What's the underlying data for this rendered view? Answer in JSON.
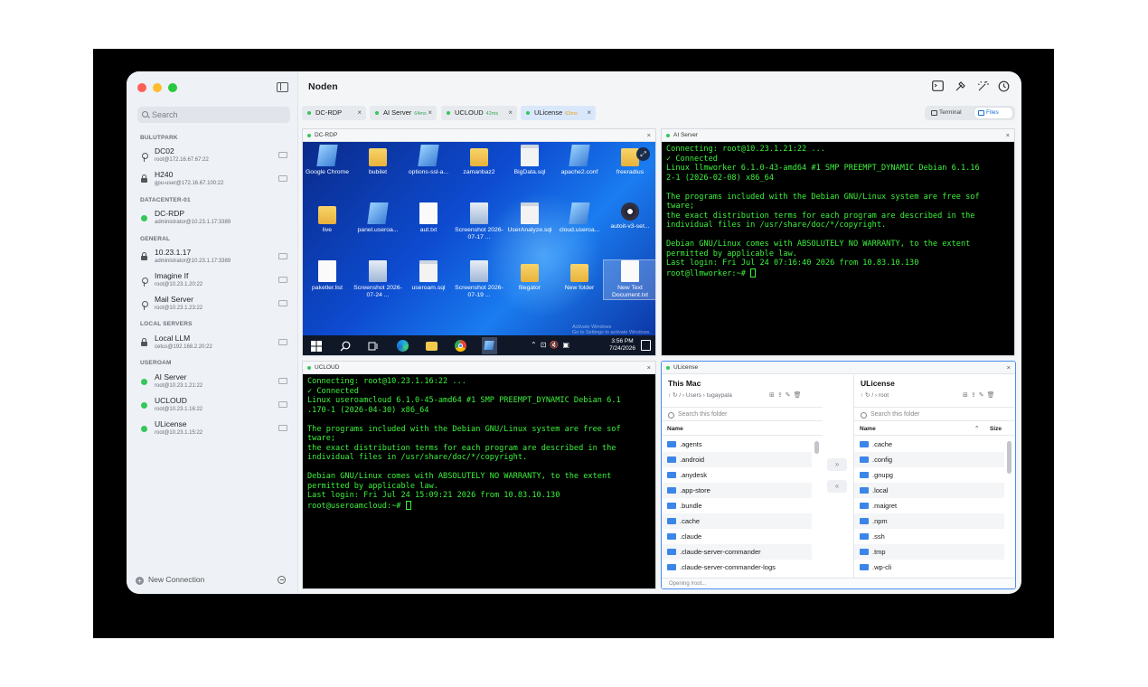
{
  "app": {
    "title": "Noden",
    "colors": {
      "close": "#ff5f57",
      "minimize": "#febc2e",
      "zoom": "#28c840",
      "accent": "#1a6fd8",
      "terminal_text": "#3cf23c",
      "online": "#34c759"
    }
  },
  "sidebar": {
    "search_placeholder": "Search",
    "groups": [
      {
        "label": "BULUTPARK",
        "items": [
          {
            "name": "DC02",
            "sub": "root@172.16.67.67:22",
            "status": "key"
          },
          {
            "name": "H240",
            "sub": "gpu-user@172.16.67.100:22",
            "status": "lock"
          }
        ]
      },
      {
        "label": "DATACENTER-01",
        "items": [
          {
            "name": "DC-RDP",
            "sub": "administrator@10.23.1.17:3389",
            "status": "online"
          }
        ]
      },
      {
        "label": "GENERAL",
        "items": [
          {
            "name": "10.23.1.17",
            "sub": "administrator@10.23.1.17:3389",
            "status": "lock"
          },
          {
            "name": "Imagine If",
            "sub": "root@10.23.1.20:22",
            "status": "key"
          },
          {
            "name": "Mail Server",
            "sub": "root@10.23.1.23:22",
            "status": "key"
          }
        ]
      },
      {
        "label": "LOCAL SERVERS",
        "items": [
          {
            "name": "Local LLM",
            "sub": "cetus@192.168.2.20:22",
            "status": "lock"
          }
        ]
      },
      {
        "label": "USEROAM",
        "items": [
          {
            "name": "AI Server",
            "sub": "root@10.23.1.21:22",
            "status": "online"
          },
          {
            "name": "UCLOUD",
            "sub": "root@10.23.1.16:22",
            "status": "online"
          },
          {
            "name": "ULicense",
            "sub": "root@10.23.1.15:22",
            "status": "online"
          }
        ]
      }
    ],
    "new_connection": "New Connection"
  },
  "toolbar": {
    "icons": [
      "terminal-window-icon",
      "hammer-icon",
      "magic-wand-icon",
      "history-icon"
    ]
  },
  "tabs": [
    {
      "label": "DC-RDP",
      "latency": ""
    },
    {
      "label": "AI Server",
      "latency": "64ms"
    },
    {
      "label": "UCLOUD",
      "latency": "42ms"
    },
    {
      "label": "ULicense",
      "latency": "63ms"
    }
  ],
  "view_toggle": {
    "terminal": "Terminal",
    "files": "Files"
  },
  "panes": {
    "rdp": {
      "title": "DC-RDP",
      "desktop_icons": [
        {
          "label": "Google Chrome",
          "kind": "app"
        },
        {
          "label": "bubilet",
          "kind": "folder"
        },
        {
          "label": "options-ssl-a...",
          "kind": "app"
        },
        {
          "label": "zamanbaz2",
          "kind": "folder"
        },
        {
          "label": "BigData.sql",
          "kind": "sql"
        },
        {
          "label": "apache2.conf",
          "kind": "app"
        },
        {
          "label": "freeradius",
          "kind": "folder"
        },
        {
          "label": "live",
          "kind": "folder"
        },
        {
          "label": "panel.userоа...",
          "kind": "app"
        },
        {
          "label": "aut.txt",
          "kind": "doc"
        },
        {
          "label": "Screenshot 2026-07-17 ...",
          "kind": "img"
        },
        {
          "label": "UserAnalyze.sql",
          "kind": "sql"
        },
        {
          "label": "cloud.useroa...",
          "kind": "app"
        },
        {
          "label": "autoit-v3-set...",
          "kind": "round"
        },
        {
          "label": "paketler.list",
          "kind": "doc"
        },
        {
          "label": "Screenshot 2026-07-24 ...",
          "kind": "img"
        },
        {
          "label": "useroam.sql",
          "kind": "sql"
        },
        {
          "label": "Screenshot 2026-07-19 ...",
          "kind": "img"
        },
        {
          "label": "filegator",
          "kind": "folder"
        },
        {
          "label": "New folder",
          "kind": "folder"
        },
        {
          "label": "New Text Document.txt",
          "kind": "doc"
        }
      ],
      "watermark": "Activate Windows\nGo to Settings to activate Windows.",
      "clock_time": "3:56 PM",
      "clock_date": "7/24/2026"
    },
    "ai_server": {
      "title": "AI Server",
      "lines": "Connecting: root@10.23.1.21:22 ...\n✓ Connected\nLinux llmworker 6.1.0-43-amd64 #1 SMP PREEMPT_DYNAMIC Debian 6.1.16\n2-1 (2026-02-08) x86_64\n\nThe programs included with the Debian GNU/Linux system are free sof\ntware;\nthe exact distribution terms for each program are described in the\nindividual files in /usr/share/doc/*/copyright.\n\nDebian GNU/Linux comes with ABSOLUTELY NO WARRANTY, to the extent\npermitted by applicable law.\nLast login: Fri Jul 24 07:16:40 2026 from 10.83.10.130\nroot@llmworker:~# "
    },
    "ucloud": {
      "title": "UCLOUD",
      "lines": "Connecting: root@10.23.1.16:22 ...\n✓ Connected\nLinux useroamcloud 6.1.0-45-amd64 #1 SMP PREEMPT_DYNAMIC Debian 6.1\n.170-1 (2026-04-30) x86_64\n\nThe programs included with the Debian GNU/Linux system are free sof\ntware;\nthe exact distribution terms for each program are described in the\nindividual files in /usr/share/doc/*/copyright.\n\nDebian GNU/Linux comes with ABSOLUTELY NO WARRANTY, to the extent\npermitted by applicable law.\nLast login: Fri Jul 24 15:09:21 2026 from 10.83.10.130\nroot@useroamcloud:~# "
    },
    "ulicense": {
      "title": "ULicense",
      "left": {
        "title": "This Mac",
        "path": "/ › Users › tugaypala",
        "search_placeholder": "Search this folder",
        "col_name": "Name",
        "files": [
          ".agents",
          ".android",
          ".anydesk",
          ".app-store",
          ".bundle",
          ".cache",
          ".claude",
          ".claude-server-commander",
          ".claude-server-commander-logs"
        ]
      },
      "right": {
        "title": "ULicense",
        "path": "/ › root",
        "search_placeholder": "Search this folder",
        "col_name": "Name",
        "col_size": "Size",
        "files": [
          ".cache",
          ".config",
          ".gnupg",
          ".local",
          ".maigret",
          ".npm",
          ".ssh",
          ".tmp",
          ".wp-cli"
        ]
      },
      "status": "Opening /root..."
    }
  }
}
